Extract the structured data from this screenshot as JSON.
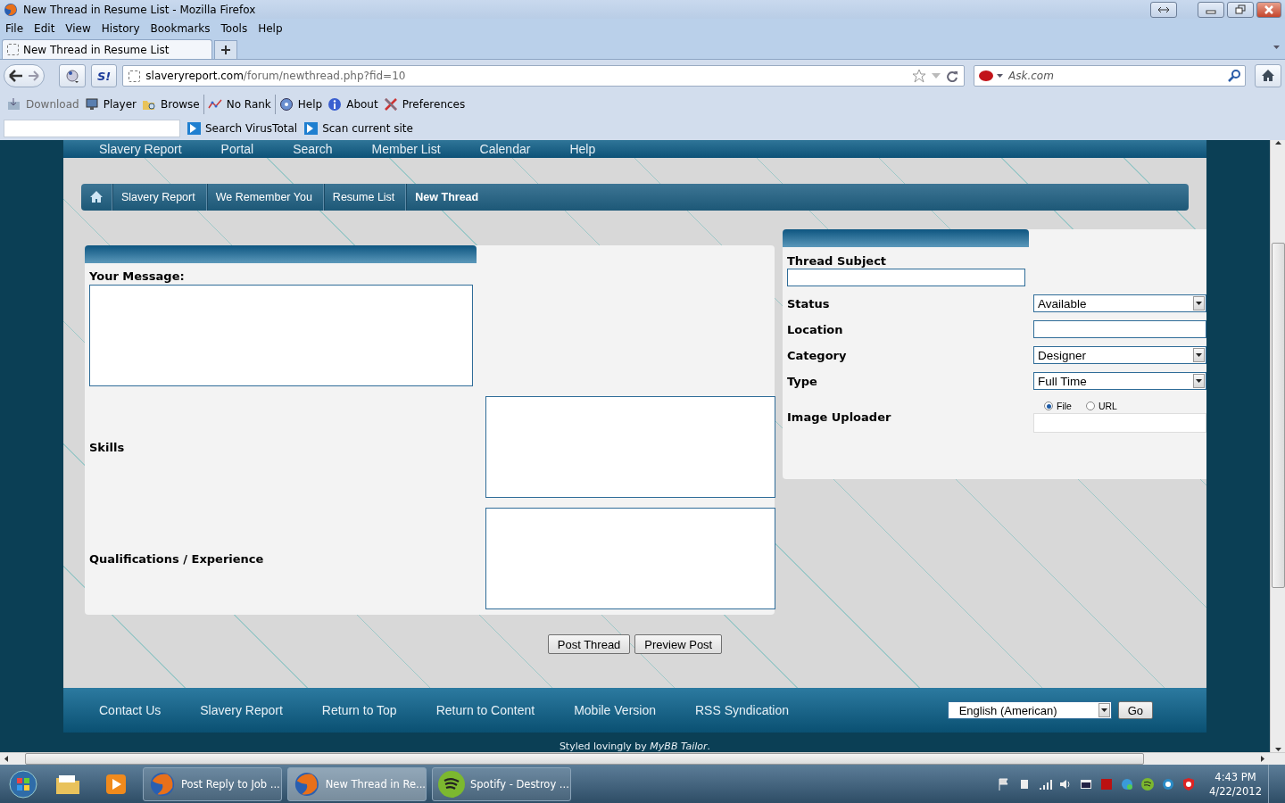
{
  "window": {
    "title": "New Thread in Resume List - Mozilla Firefox"
  },
  "menu_bar": [
    "File",
    "Edit",
    "View",
    "History",
    "Bookmarks",
    "Tools",
    "Help"
  ],
  "tabs": [
    {
      "label": "New Thread in Resume List",
      "selected": true
    }
  ],
  "nav_bar": {
    "addon_button": "S!",
    "url_host": "slaveryreport.com",
    "url_path": "/forum/newthread.php?fid=10",
    "search_placeholder": "Ask.com"
  },
  "bookmarks_toolbar": [
    [
      {
        "label": "Download",
        "disabled": true
      },
      {
        "label": "Player",
        "disabled": false
      },
      {
        "label": "Browse",
        "disabled": false
      }
    ],
    [
      {
        "label": "No Rank",
        "disabled": false
      }
    ],
    [
      {
        "label": "Help",
        "disabled": false
      },
      {
        "label": "About",
        "disabled": false
      },
      {
        "label": "Preferences",
        "disabled": false
      }
    ]
  ],
  "virustotal_toolbar": {
    "buttons": [
      "Search VirusTotal",
      "Scan current site"
    ]
  },
  "page": {
    "top_nav": [
      "Slavery Report",
      "Portal",
      "Search",
      "Member List",
      "Calendar",
      "Help"
    ],
    "breadcrumb": [
      {
        "label": "Slavery Report",
        "selected": false
      },
      {
        "label": "We Remember You",
        "selected": false
      },
      {
        "label": "Resume List",
        "selected": false
      },
      {
        "label": "New Thread",
        "selected": true
      }
    ],
    "message_label": "Your Message:",
    "left_rows": [
      {
        "label": "Skills"
      },
      {
        "label": "Qualifications / Experience"
      }
    ],
    "subject_label": "Thread Subject",
    "right_rows": [
      {
        "label": "Status",
        "kind": "select",
        "value": "Available"
      },
      {
        "label": "Location",
        "kind": "text"
      },
      {
        "label": "Category",
        "kind": "select",
        "value": "Designer"
      },
      {
        "label": "Type",
        "kind": "select",
        "value": "Full Time"
      },
      {
        "label": "Image Uploader",
        "kind": "upload",
        "options": [
          {
            "label": "File",
            "selected": true
          },
          {
            "label": "URL",
            "selected": false
          }
        ]
      }
    ],
    "buttons": [
      "Post Thread",
      "Preview Post"
    ],
    "footer_links": [
      "Contact Us",
      "Slavery Report",
      "Return to Top",
      "Return to Content",
      "Mobile Version",
      "RSS Syndication"
    ],
    "language": "English (American)",
    "go_button": "Go",
    "credit": "Styled lovingly by *MyBB Tailor*."
  },
  "taskbar": {
    "tasks": [
      {
        "label": "Post Reply to Job ...",
        "selected": false
      },
      {
        "label": "New Thread in Re...",
        "selected": true
      },
      {
        "label": "Spotify - Destroy ...",
        "selected": false
      }
    ],
    "time": "4:43 PM",
    "date": "4/22/2012"
  }
}
